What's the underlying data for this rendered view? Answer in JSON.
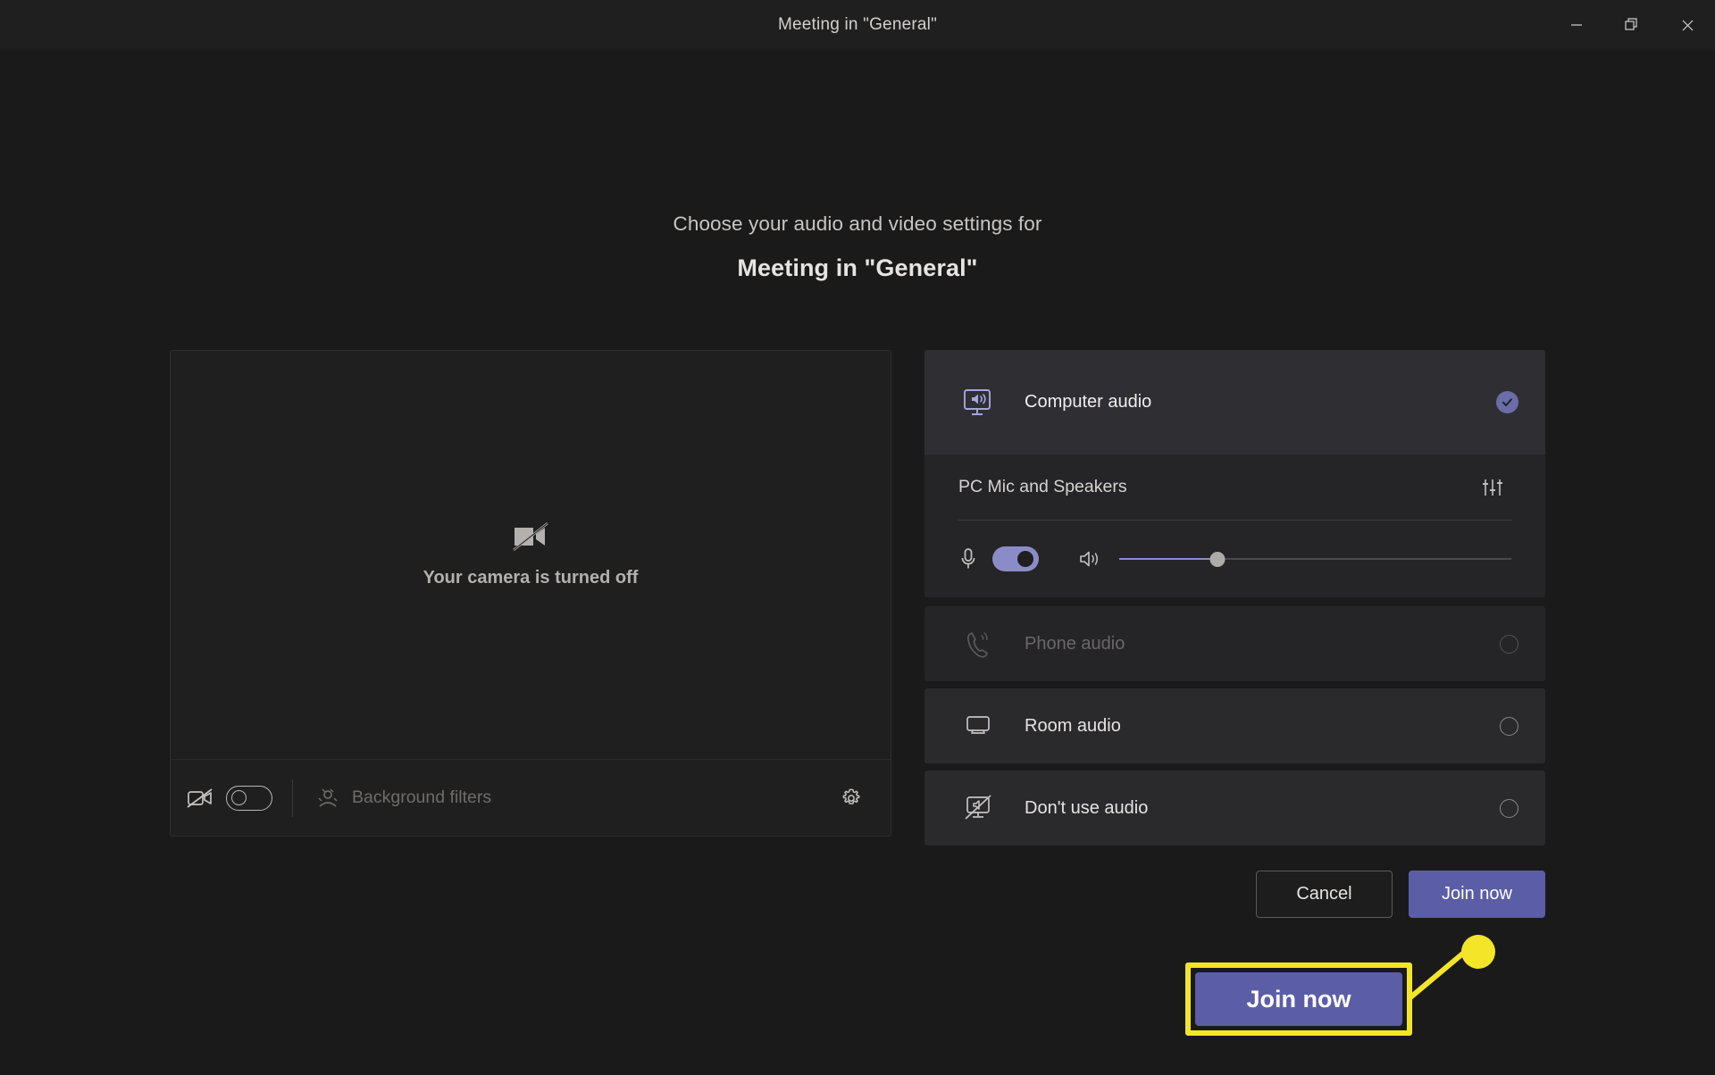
{
  "window": {
    "title": "Meeting in \"General\"",
    "controls": [
      {
        "name": "minimize",
        "label": "Minimize"
      },
      {
        "name": "restore",
        "label": "Restore"
      },
      {
        "name": "close",
        "label": "Close"
      }
    ]
  },
  "heading": {
    "subtitle": "Choose your audio and video settings for",
    "meeting_title": "Meeting in \"General\""
  },
  "video_panel": {
    "camera_status": "Your camera is turned off",
    "camera_icon": "camera-off-icon",
    "camera_toggle": {
      "icon": "camera-off-icon",
      "state": "off"
    },
    "background_filters": {
      "icon": "background-filters-icon",
      "label": "Background filters",
      "enabled": false
    },
    "settings_icon": "gear-icon"
  },
  "audio_options": [
    {
      "id": "computer-audio",
      "icon": "monitor-speaker-icon",
      "label": "Computer audio",
      "selected": true,
      "disabled": false,
      "device": {
        "name": "PC Mic and Speakers",
        "sliders_icon": "audio-sliders-icon",
        "mic": {
          "icon": "microphone-icon",
          "state": "on"
        },
        "speaker": {
          "icon": "speaker-icon"
        },
        "volume_percent": 25
      }
    },
    {
      "id": "phone-audio",
      "icon": "phone-icon",
      "label": "Phone audio",
      "selected": false,
      "disabled": true
    },
    {
      "id": "room-audio",
      "icon": "monitor-icon",
      "label": "Room audio",
      "selected": false,
      "disabled": false
    },
    {
      "id": "dont-use-audio",
      "icon": "audio-off-icon",
      "label": "Don't use audio",
      "selected": false,
      "disabled": false
    }
  ],
  "actions": {
    "cancel_label": "Cancel",
    "join_label": "Join now"
  },
  "callout": {
    "button_label": "Join now",
    "highlight_color": "#f5e529",
    "accent_color": "#5b5ea6"
  }
}
